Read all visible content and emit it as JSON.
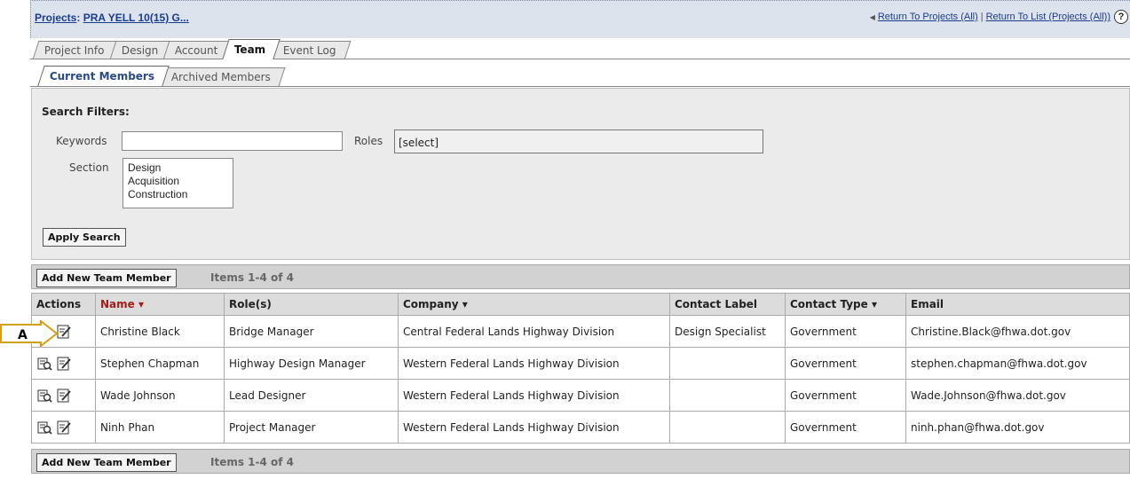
{
  "breadcrumb": {
    "root": "Projects",
    "sep": ":",
    "project": "PRA YELL 10(15) G..."
  },
  "header_links": {
    "return_all": "Return To Projects (All)",
    "separator": "|",
    "return_list": "Return To List (Projects (All))",
    "help": "?"
  },
  "main_tabs": [
    "Project Info",
    "Design",
    "Account",
    "Team",
    "Event Log"
  ],
  "active_main_tab": "Team",
  "sub_tabs": [
    "Current Members",
    "Archived Members"
  ],
  "active_sub_tab": "Current Members",
  "filters": {
    "title": "Search Filters:",
    "keywords_label": "Keywords",
    "keywords_value": "",
    "roles_label": "Roles",
    "roles_value": "[select]",
    "section_label": "Section",
    "section_options": [
      "Design",
      "Acquisition",
      "Construction"
    ],
    "apply_label": "Apply Search"
  },
  "results": {
    "add_label": "Add New Team Member",
    "count_text": "Items 1-4 of 4",
    "columns": [
      "Actions",
      "Name ▾",
      "Role(s)",
      "Company ▾",
      "Contact Label",
      "Contact Type ▾",
      "Email"
    ],
    "rows": [
      {
        "name": "Christine Black",
        "role": "Bridge Manager",
        "company": "Central Federal Lands Highway Division",
        "label": "Design Specialist",
        "type": "Government",
        "email": "Christine.Black@fhwa.dot.gov"
      },
      {
        "name": "Stephen Chapman",
        "role": "Highway Design Manager",
        "company": "Western Federal Lands Highway Division",
        "label": "",
        "type": "Government",
        "email": "stephen.chapman@fhwa.dot.gov"
      },
      {
        "name": "Wade Johnson",
        "role": "Lead Designer",
        "company": "Western Federal Lands Highway Division",
        "label": "",
        "type": "Government",
        "email": "Wade.Johnson@fhwa.dot.gov"
      },
      {
        "name": "Ninh Phan",
        "role": "Project Manager",
        "company": "Western Federal Lands Highway Division",
        "label": "",
        "type": "Government",
        "email": "ninh.phan@fhwa.dot.gov"
      }
    ]
  },
  "callout": {
    "letter": "A"
  },
  "colors": {
    "link": "#1a3c8c",
    "sort_header": "#a41c1c",
    "header_bg": "#dde3ec",
    "callout_border": "#d4a017"
  }
}
